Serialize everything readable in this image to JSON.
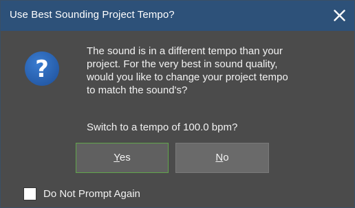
{
  "dialog": {
    "title": "Use Best Sounding Project Tempo?",
    "message": "The sound is in a different tempo than your\nproject.  For the very best in sound quality,\nwould you like to change your project tempo\nto match the sound's?",
    "prompt": "Switch to a tempo of 100.0 bpm?",
    "yes": {
      "accel": "Y",
      "rest": "es"
    },
    "no": {
      "accel": "N",
      "rest": "o"
    },
    "checkbox_label": "Do Not Prompt Again",
    "checkbox_checked": false
  },
  "icons": {
    "close": "close-icon",
    "question": "question-icon"
  },
  "colors": {
    "titlebar": "#2d5179",
    "body": "#4b4b4b",
    "icon_circle": "#2a61b0",
    "yes_border": "#62a64c"
  }
}
